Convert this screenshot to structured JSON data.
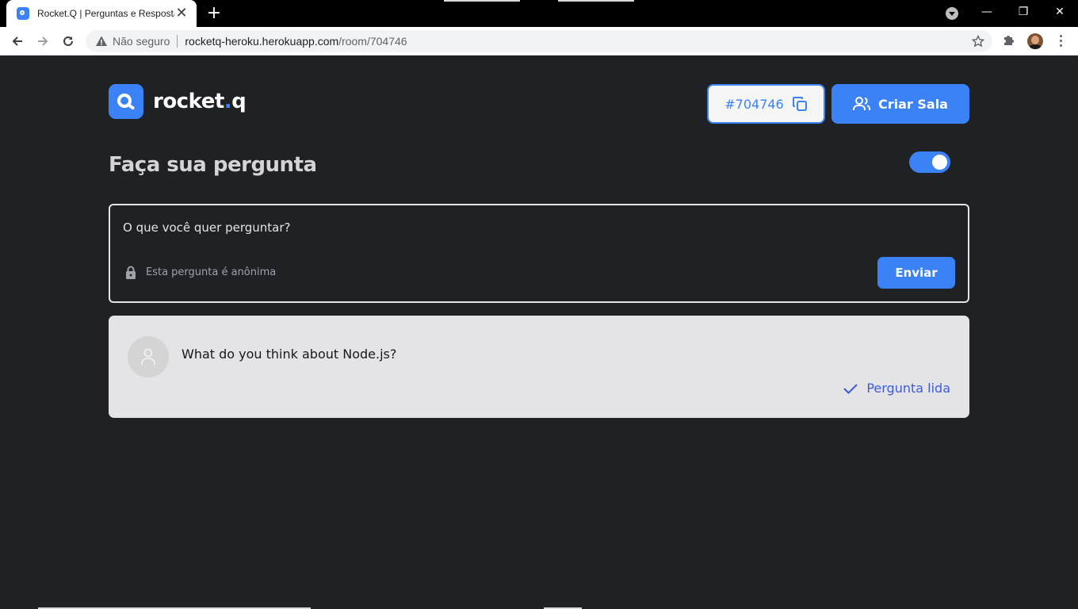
{
  "browser": {
    "tab_title": "Rocket.Q | Perguntas e Respostas",
    "tab_close": "✕",
    "new_tab": "+",
    "security_label": "Não seguro",
    "url_host": "rocketq-heroku.herokuapp.com",
    "url_path": "/room/704746",
    "window_controls": {
      "minimize": "—",
      "restore": "❐",
      "close": "✕"
    }
  },
  "header": {
    "logo_text": "rocket",
    "logo_dot": ".",
    "logo_suffix": "q",
    "room_code": "#704746",
    "create_room_label": "Criar Sala"
  },
  "main": {
    "heading": "Faça sua pergunta",
    "dark_mode_toggle_on": true,
    "question_form": {
      "placeholder": "O que você quer perguntar?",
      "anonymous_label": "Esta pergunta é anônima",
      "send_label": "Enviar"
    },
    "questions": [
      {
        "text": "What do you think about Node.js?",
        "status_label": "Pergunta lida"
      }
    ]
  },
  "colors": {
    "accent": "#3b82f6",
    "background": "#202124",
    "card": "#e4e4e7",
    "read_status": "#3b5bdb"
  }
}
